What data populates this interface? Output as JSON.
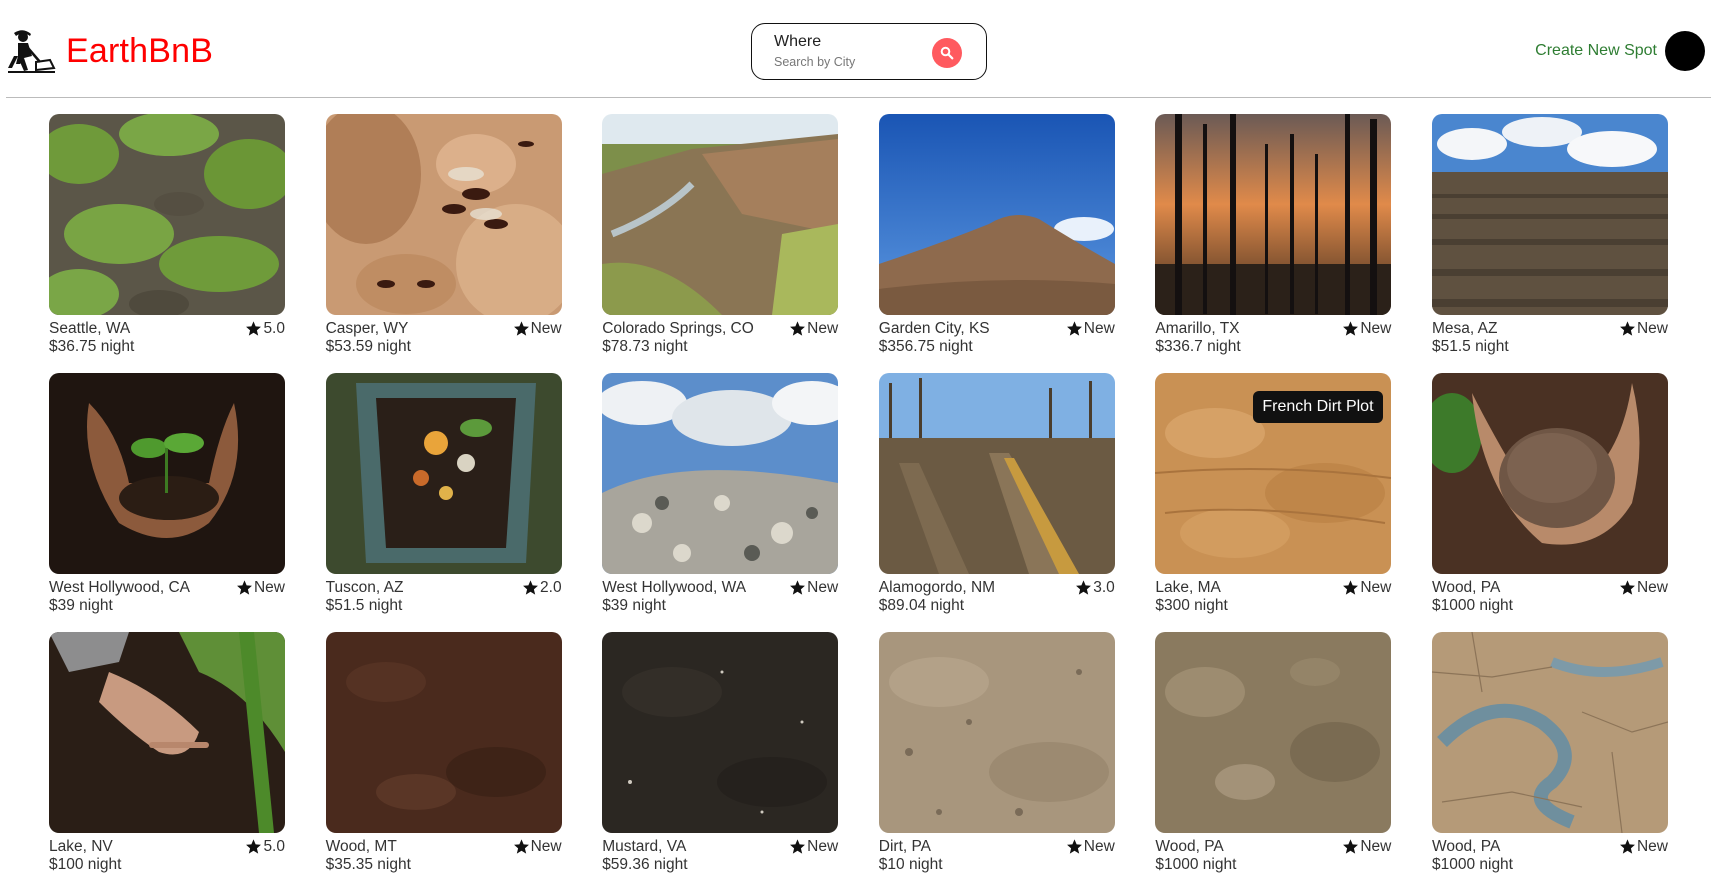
{
  "brand": {
    "name": "EarthBnB",
    "color": "#ff0000"
  },
  "search": {
    "label": "Where",
    "placeholder": "Search by City",
    "button_color": "#ff5a5f"
  },
  "header": {
    "create_label": "Create New Spot"
  },
  "tooltip": {
    "text": "French Dirt Plot"
  },
  "spots": [
    {
      "city": "Seattle, WA",
      "rating": "5.0",
      "price": "$36.75 night",
      "image": "grass-patches"
    },
    {
      "city": "Casper, WY",
      "rating": "New",
      "price": "$53.59 night",
      "image": "ants-on-soil"
    },
    {
      "city": "Colorado Springs, CO",
      "rating": "New",
      "price": "$78.73 night",
      "image": "eroded-creek"
    },
    {
      "city": "Garden City, KS",
      "rating": "New",
      "price": "$356.75 night",
      "image": "dirt-mound"
    },
    {
      "city": "Amarillo, TX",
      "rating": "New",
      "price": "$336.7 night",
      "image": "burnt-forest"
    },
    {
      "city": "Mesa, AZ",
      "rating": "New",
      "price": "$51.5 night",
      "image": "plowed-field"
    },
    {
      "city": "West Hollywood, CA",
      "rating": "New",
      "price": "$39 night",
      "image": "hands-with-seedling"
    },
    {
      "city": "Tuscon, AZ",
      "rating": "2.0",
      "price": "$51.5 night",
      "image": "compost-bin"
    },
    {
      "city": "West Hollywood, WA",
      "rating": "New",
      "price": "$39 night",
      "image": "landfill"
    },
    {
      "city": "Alamogordo, NM",
      "rating": "3.0",
      "price": "$89.04 night",
      "image": "muddy-track"
    },
    {
      "city": "Lake, MA",
      "rating": "New",
      "price": "$300 night",
      "image": "dry-clay",
      "hovered": true
    },
    {
      "city": "Wood, PA",
      "rating": "New",
      "price": "$1000 night",
      "image": "hands-with-soil"
    },
    {
      "city": "Lake, NV",
      "rating": "5.0",
      "price": "$100 night",
      "image": "hand-on-soil"
    },
    {
      "city": "Wood, MT",
      "rating": "New",
      "price": "$35.35 night",
      "image": "brown-soil"
    },
    {
      "city": "Mustard, VA",
      "rating": "New",
      "price": "$59.36 night",
      "image": "dark-soil"
    },
    {
      "city": "Dirt, PA",
      "rating": "New",
      "price": "$10 night",
      "image": "sandy-soil"
    },
    {
      "city": "Wood, PA",
      "rating": "New",
      "price": "$1000 night",
      "image": "rocky-soil"
    },
    {
      "city": "Wood, PA",
      "rating": "New",
      "price": "$1000 night",
      "image": "cracked-earth"
    }
  ]
}
